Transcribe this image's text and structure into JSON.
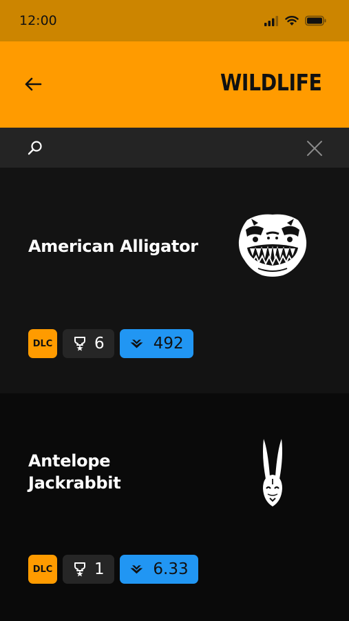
{
  "status": {
    "time": "12:00"
  },
  "header": {
    "title": "WILDLIFE"
  },
  "search": {
    "value": "",
    "placeholder": ""
  },
  "animals": [
    {
      "name": "American Alligator",
      "dlc_label": "DLC",
      "trophies": "6",
      "score": "492"
    },
    {
      "name": "Antelope Jackrabbit",
      "dlc_label": "DLC",
      "trophies": "1",
      "score": "6.33"
    }
  ],
  "colors": {
    "accent": "#ff9b00",
    "status_bar": "#cc8500",
    "score_badge": "#2196f3"
  }
}
